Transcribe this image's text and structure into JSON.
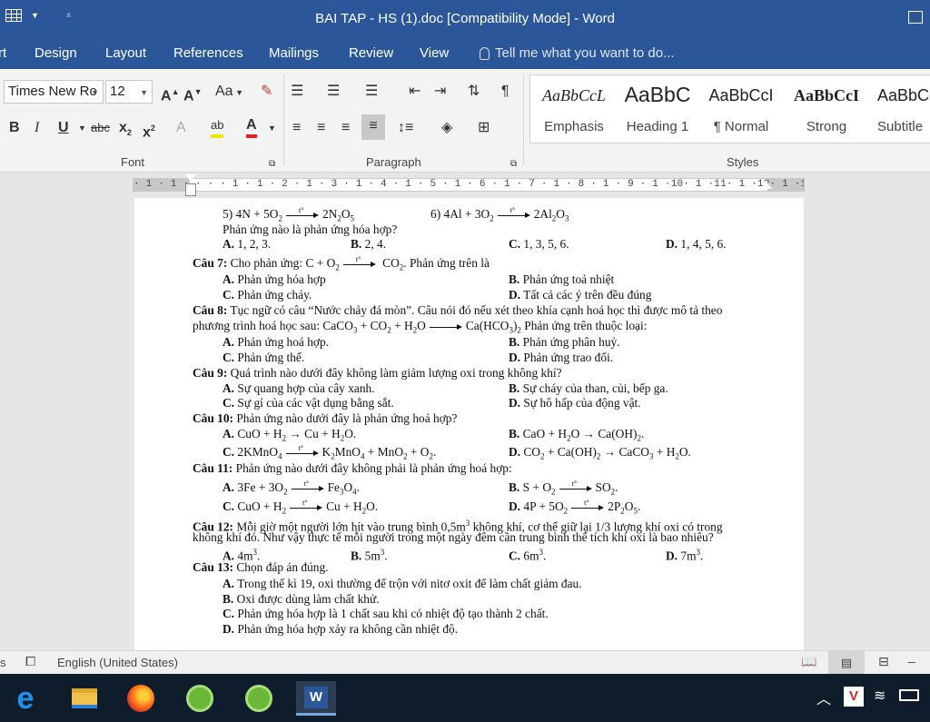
{
  "titlebar": {
    "title": "BAI TAP  - HS  (1).doc [Compatibility Mode] - Word"
  },
  "tabs": [
    "rt",
    "Design",
    "Layout",
    "References",
    "Mailings",
    "Review",
    "View"
  ],
  "tell_me": "Tell me what you want to do...",
  "ribbon": {
    "font_name": "Times New Ro",
    "font_size": "12",
    "font_group": "Font",
    "paragraph_group": "Paragraph",
    "styles_group": "Styles",
    "change_case": "Aa",
    "styles": [
      {
        "sample": "AaBbCcL",
        "name": "Emphasis"
      },
      {
        "sample": "AaBbC",
        "name": "Heading 1"
      },
      {
        "sample": "AaBbCcI",
        "name": "¶ Normal"
      },
      {
        "sample": "AaBbCcI",
        "name": "Strong"
      },
      {
        "sample": "AaBbCc",
        "name": "Subtitle"
      }
    ]
  },
  "ruler": "· 1 · 1 · · · · 1 · 1 · 2 · 1 · 3 · 1 · 4 · 1 · 5 · 1 · 6 · 1 · 7 · 1 · 8 · 1 · 9 · 1 ·10· 1 ·11· 1 ·12· 1 ·13· 1 ·14· 1 ·15· 1 ·16· 1 ·17· 1 ·18· · ·19·",
  "doc": {
    "l1a": "5) 4N  +  5O",
    "l1b": "2N",
    "l1c": "6) 4Al  +  3O",
    "l1d": "2Al",
    "l2": "Phản ứng nào là phản ứng hóa hợp?",
    "l3": [
      "A.",
      " 1, 2, 3.",
      "B.",
      " 2, 4.",
      "C.",
      " 1, 3, 5, 6.",
      "D.",
      " 1, 4, 5, 6."
    ],
    "q7": {
      "label": "Câu 7:",
      "text1": " Cho phản ứng: C + O",
      "text2": " CO",
      "text3": ". Phản ứng trên là",
      "A": "Phản ứng hóa hợp",
      "B": "Phản ứng toả nhiệt",
      "C": "Phản ứng cháy.",
      "D": "Tất cả các ý trên đều đúng"
    },
    "q8": {
      "label": "Câu 8:",
      "text1": " Tục ngữ có câu “Nước chảy đá mòn”. Câu nói đó nếu xét theo khía cạnh hoá học thì được mô tả theo",
      "text2a": "phương trình hoá học sau: CaCO",
      "text2b": "  +  CO",
      "text2c": "  +  H",
      "text2d": "O",
      "text2e": "Ca(HCO",
      "text2f": ")",
      "text2g": " Phản ứng trên thuộc loại:",
      "A": "Phản ứng hoá hợp.",
      "B": "Phản ứng phân huỷ.",
      "C": "Phản ứng thế.",
      "D": "Phản ứng trao đổi."
    },
    "q9": {
      "label": "Câu 9:",
      "text": " Quá trình nào dưới đây không làm giảm lượng oxi trong không khí?",
      "A": "Sự quang hợp của cây xanh.",
      "B": "Sự cháy của than, củi, bếp ga.",
      "C": "Sự gỉ của các vật dụng bằng sắt.",
      "D": "Sự hô hấp của động vật."
    },
    "q10": {
      "label": "Câu 10:",
      "text": " Phản ứng nào dưới đây là phản ứng hoá hợp?"
    },
    "q11": {
      "label": "Câu 11:",
      "text": " Phản ứng nào dưới đây không phải là phản ứng hoá hợp:"
    },
    "q12": {
      "label": "Câu 12:",
      "text1": " Mỗi giờ một người lớn hít vào trung bình 0,5m",
      "text1b": " không khí, cơ thể giữ lại 1/3 lượng khí oxi có trong",
      "text2": "không khí đó. Như vậy thực tế mỗi người trong một ngày đêm cần trung bình thể tích khí oxi là bao nhiêu?",
      "A": " 4m",
      "B": " 5m",
      "C": " 6m",
      "D": " 7m"
    },
    "q13": {
      "label": "Câu 13:",
      "text": " Chọn đáp án đúng.",
      "A": " Trong thế kì 19, oxi thường để trộn với nitơ oxit để làm chất giảm đau.",
      "B": " Oxi được dùng làm chất khử.",
      "C": " Phản ứng hóa hợp là 1 chất sau khi có nhiệt độ tạo thành 2 chất.",
      "D": " Phản ứng hóa hợp xảy ra không cần nhiệt độ."
    },
    "letters": {
      "A": "A.",
      "B": "B.",
      "C": "C.",
      "D": "D."
    }
  },
  "status": {
    "left": "s",
    "language": "English (United States)"
  },
  "colors": {
    "word_blue": "#2b579a",
    "taskbar": "#0f1c2c"
  }
}
